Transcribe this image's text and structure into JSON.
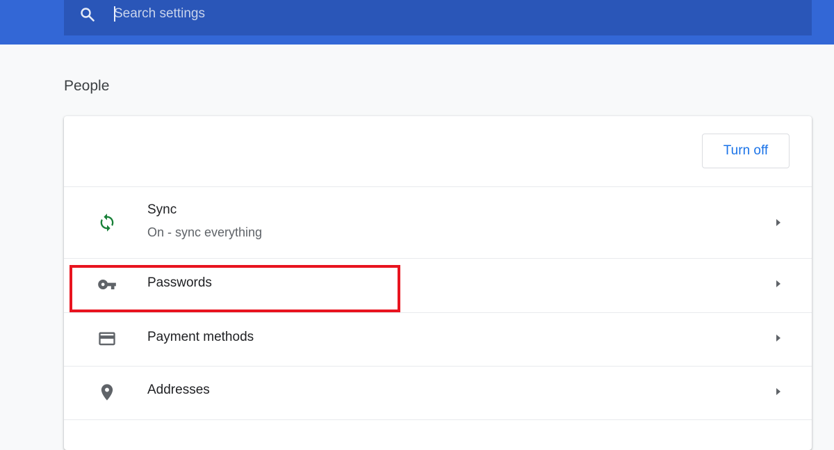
{
  "search": {
    "placeholder": "Search settings",
    "icon": "search-icon"
  },
  "section": {
    "title": "People"
  },
  "header": {
    "turn_off_label": "Turn off"
  },
  "items": [
    {
      "label": "Sync",
      "sublabel": "On - sync everything",
      "icon": "sync-icon"
    },
    {
      "label": "Passwords",
      "icon": "key-icon"
    },
    {
      "label": "Payment methods",
      "icon": "credit-card-icon"
    },
    {
      "label": "Addresses",
      "icon": "location-pin-icon"
    }
  ],
  "colors": {
    "header_blue": "#3367d6",
    "search_bg": "#2a56b8",
    "accent": "#1a73e8",
    "sync_green": "#188038",
    "highlight_red": "#e8141f"
  }
}
